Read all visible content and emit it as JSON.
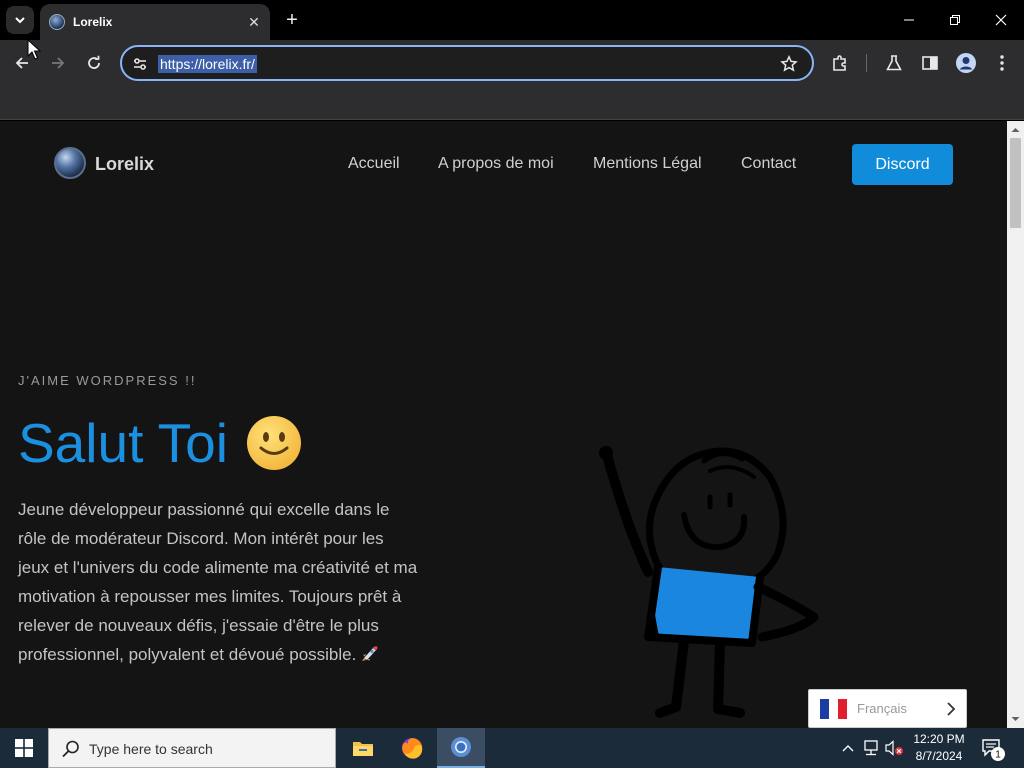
{
  "browser": {
    "tab_title": "Lorelix",
    "tab_close": "✕",
    "new_tab": "+",
    "url": "https://lorelix.fr/"
  },
  "site": {
    "logo_text": "Lorelix",
    "nav": {
      "home": "Accueil",
      "about": "A propos de moi",
      "legal": "Mentions Légal",
      "contact": "Contact",
      "discord": "Discord"
    },
    "hero": {
      "kicker": "J'AIME WORDPRESS !!",
      "title": "Salut Toi",
      "text": "Jeune développeur passionné qui excelle dans le rôle de modérateur Discord. Mon intérêt pour les jeux et l'univers du code alimente ma créativité et ma motivation à repousser mes limites. Toujours prêt à relever de nouveaux défis, j'essaie d'être le plus professionnel, polyvalent et dévoué possible."
    },
    "language": {
      "label": "Français"
    }
  },
  "taskbar": {
    "search_placeholder": "Type here to search",
    "time": "12:20 PM",
    "date": "8/7/2024",
    "notification_count": "1"
  },
  "colors": {
    "accent": "#118cdb",
    "hero_title": "#1b8fe0",
    "page_bg": "#141414",
    "character_shirt": "#1a86e0"
  }
}
